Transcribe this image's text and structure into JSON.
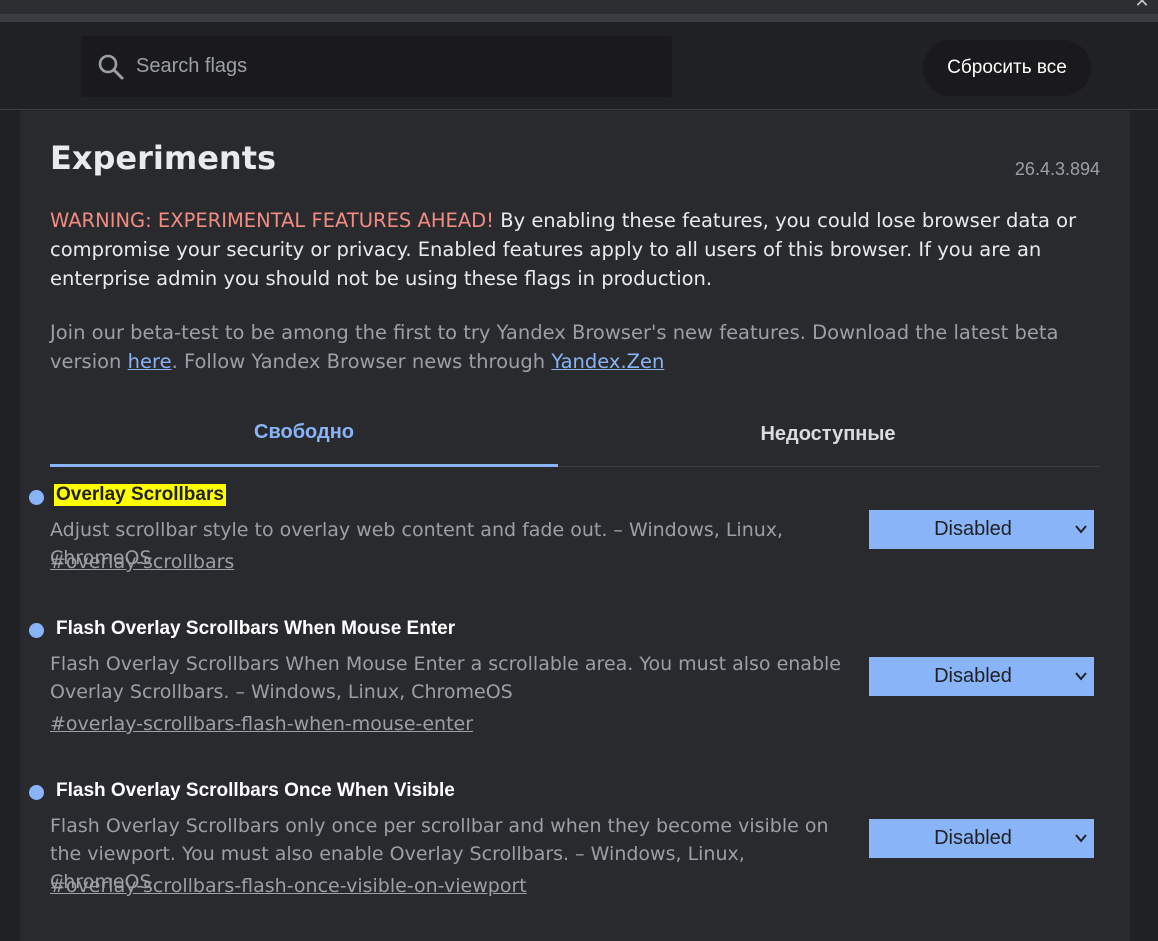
{
  "header": {
    "search_placeholder": "Search flags",
    "reset_label": "Сбросить все",
    "close_glyph": "✕"
  },
  "main": {
    "title": "Experiments",
    "version": "26.4.3.894",
    "warning_label": "WARNING: EXPERIMENTAL FEATURES AHEAD!",
    "warning_text": " By enabling these features, you could lose browser data or compromise your security or privacy. Enabled features apply to all users of this browser. If you are an enterprise admin you should not be using these flags in production.",
    "beta_text_1": "Join our beta-test to be among the first to try Yandex Browser's new features. Download the latest beta version ",
    "beta_link_1": "here",
    "beta_text_2": ". Follow Yandex Browser news through ",
    "beta_link_2": "Yandex.Zen",
    "tabs": [
      {
        "label": "Свободно",
        "active": true
      },
      {
        "label": "Недоступные",
        "active": false
      }
    ]
  },
  "flags": [
    {
      "name": "Overlay Scrollbars",
      "description": "Adjust scrollbar style to overlay web content and fade out. – Windows, Linux, ChromeOS",
      "anchor": "#overlay-scrollbars",
      "value": "Disabled",
      "highlighted": true
    },
    {
      "name": "Flash Overlay Scrollbars When Mouse Enter",
      "description": "Flash Overlay Scrollbars When Mouse Enter a scrollable area. You must also enable Overlay Scrollbars. – Windows, Linux, ChromeOS",
      "anchor": "#overlay-scrollbars-flash-when-mouse-enter",
      "value": "Disabled",
      "highlighted": false
    },
    {
      "name": "Flash Overlay Scrollbars Once When Visible",
      "description": "Flash Overlay Scrollbars only once per scrollbar and when they become visible on the viewport. You must also enable Overlay Scrollbars. – Windows, Linux, ChromeOS",
      "anchor": "#overlay-scrollbars-flash-once-visible-on-viewport",
      "value": "Disabled",
      "highlighted": false
    }
  ],
  "colors": {
    "accent": "#8ab4f8",
    "warning": "#f28b82",
    "highlight": "#ffff00",
    "background": "#202124",
    "panel": "#292a2d"
  },
  "icons": {
    "search": "search-icon",
    "dropdown": "chevron-down-icon",
    "bullet": "flag-dot-icon"
  }
}
